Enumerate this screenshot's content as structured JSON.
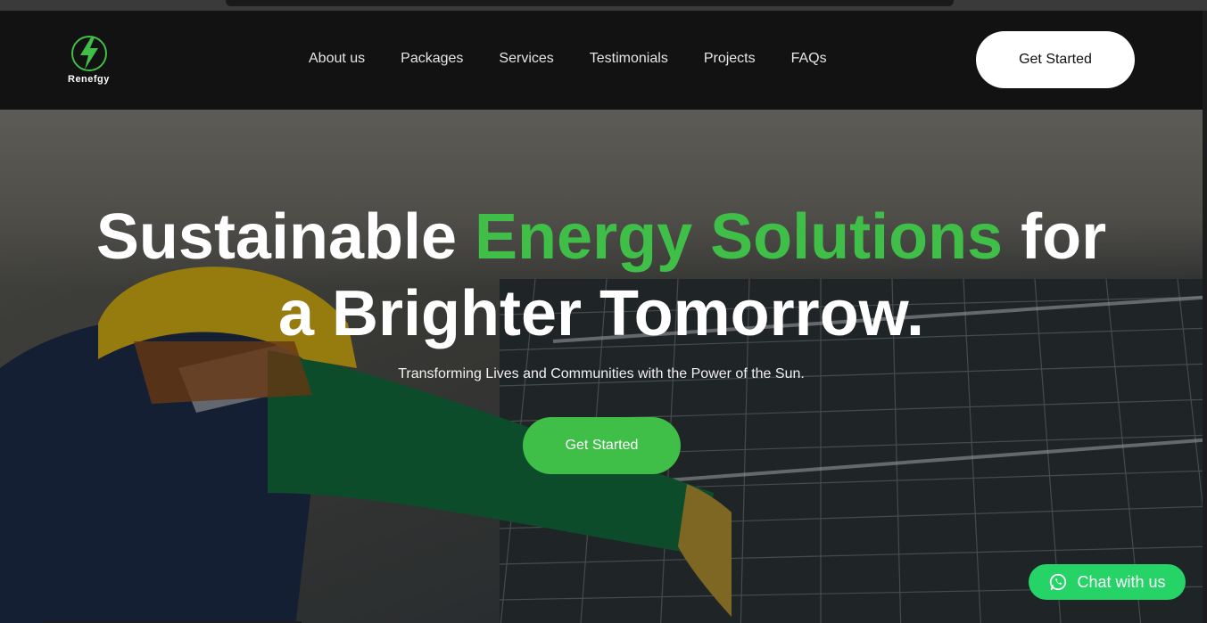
{
  "brand": {
    "name": "Renefgy",
    "accent": "#3fbf47",
    "logo_icon": "lightning-bolt-icon"
  },
  "nav": {
    "items": [
      {
        "label": "About us"
      },
      {
        "label": "Packages"
      },
      {
        "label": "Services"
      },
      {
        "label": "Testimonials"
      },
      {
        "label": "Projects"
      },
      {
        "label": "FAQs"
      }
    ],
    "cta_label": "Get Started"
  },
  "hero": {
    "headline_part1": "Sustainable ",
    "headline_highlight": "Energy Solutions",
    "headline_part2": " for",
    "headline_line2": "a Brighter Tomorrow.",
    "subtitle": "Transforming Lives and Communities with the Power of the Sun.",
    "cta_label": "Get Started"
  },
  "chat": {
    "label": "Chat with us",
    "icon": "whatsapp-icon",
    "color": "#25d366"
  }
}
